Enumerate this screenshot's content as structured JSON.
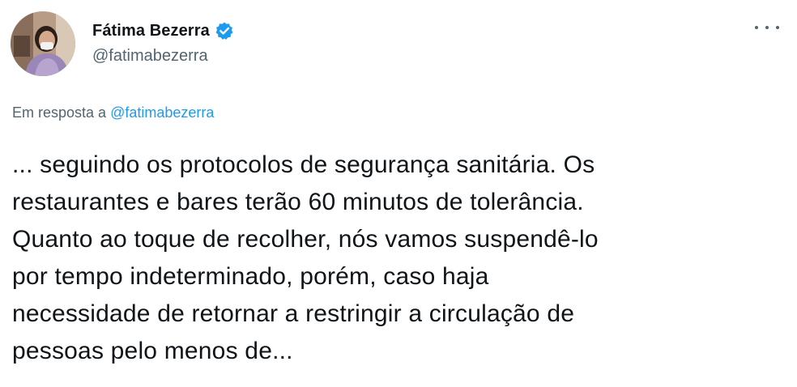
{
  "author": {
    "display_name": "Fátima Bezerra",
    "handle": "@fatimabezerra",
    "verified_icon": "verified-badge-icon"
  },
  "reply_context": {
    "prefix": "Em resposta a",
    "mention": "@fatimabezerra"
  },
  "tweet": {
    "lines": [
      "... seguindo os protocolos de segurança sanitária. Os",
      "restaurantes e bares terão 60 minutos de tolerância.",
      "Quanto ao toque de recolher, nós vamos suspendê-lo",
      "por tempo indeterminado, porém, caso haja",
      "necessidade de retornar a restringir a circulação de",
      "pessoas pelo menos de..."
    ]
  },
  "colors": {
    "text": "#0f1419",
    "secondary": "#536471",
    "accent": "#1d9bf0"
  }
}
